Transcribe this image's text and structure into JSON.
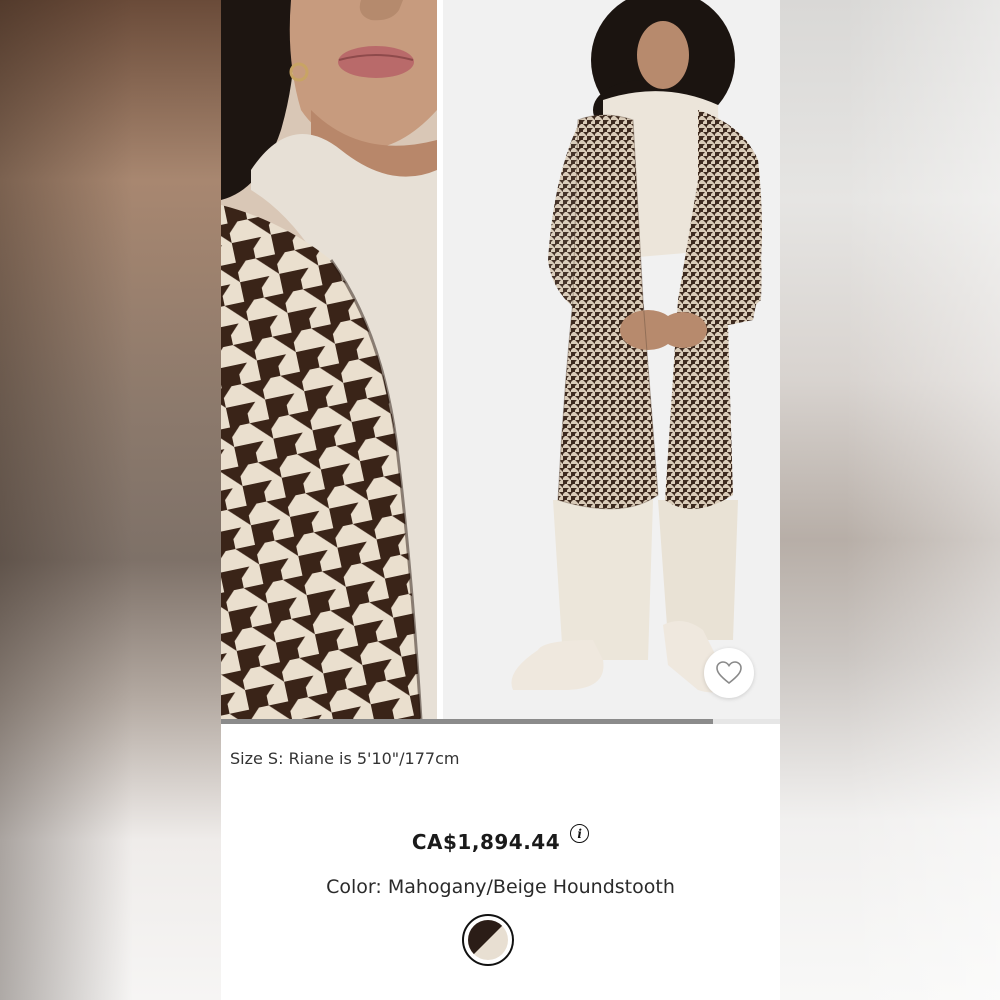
{
  "product": {
    "model_note": "Size S: Riane is 5'10\"/177cm",
    "price": "CA$1,894.44",
    "info_icon_glyph": "i",
    "color_label": "Color: Mahogany/Beige Houndstooth"
  },
  "gallery": {
    "progress": 0.88,
    "images": [
      {
        "icon": "coat-detail-photo"
      },
      {
        "icon": "model-full-length-photo"
      }
    ]
  },
  "colors": {
    "accent": "#111111",
    "houndstooth_dark": "#3a2418",
    "houndstooth_light": "#eadfce",
    "swatch_dark": "#2b1d17",
    "swatch_light": "#e8dfd2"
  },
  "icons": {
    "favorite": "heart-icon",
    "info": "info-icon"
  }
}
